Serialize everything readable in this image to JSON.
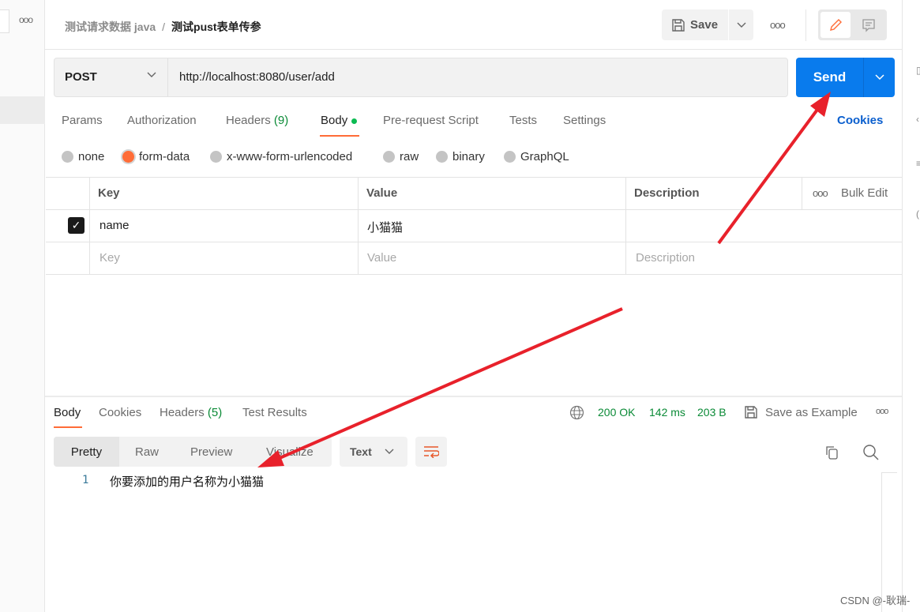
{
  "breadcrumb": {
    "parent": "测试请求数据 java",
    "separator": "/",
    "current": "测试pust表单传参"
  },
  "toolbar": {
    "save_label": "Save"
  },
  "request": {
    "method": "POST",
    "url": "http://localhost:8080/user/add",
    "send_label": "Send"
  },
  "tabs": {
    "params": "Params",
    "authorization": "Authorization",
    "headers": "Headers",
    "headers_count": "(9)",
    "body": "Body",
    "prerequest": "Pre-request Script",
    "tests": "Tests",
    "settings": "Settings",
    "cookies": "Cookies"
  },
  "body_types": {
    "selected": "form-data",
    "options": [
      "none",
      "form-data",
      "x-www-form-urlencoded",
      "raw",
      "binary",
      "GraphQL"
    ]
  },
  "table": {
    "headers": [
      "Key",
      "Value",
      "Description"
    ],
    "bulk_edit": "Bulk Edit",
    "rows": [
      {
        "checked": true,
        "key": "name",
        "value": "小猫猫",
        "description": ""
      }
    ],
    "placeholders": {
      "key": "Key",
      "value": "Value",
      "description": "Description"
    }
  },
  "response": {
    "tabs": {
      "body": "Body",
      "cookies": "Cookies",
      "headers": "Headers",
      "headers_count": "(5)",
      "test_results": "Test Results"
    },
    "status": "200 OK",
    "time": "142 ms",
    "size": "203 B",
    "save_example": "Save as Example",
    "views": [
      "Pretty",
      "Raw",
      "Preview",
      "Visualize"
    ],
    "selected_view": "Pretty",
    "format": "Text",
    "lines": [
      {
        "no": "1",
        "text": "你要添加的用户名称为小猫猫"
      }
    ]
  },
  "watermark": "CSDN @-耿瑞-",
  "colors": {
    "accent": "#ff6c37",
    "send": "#097bed",
    "status_ok": "#0a8a36",
    "annotation_arrow": "#e8212b"
  }
}
